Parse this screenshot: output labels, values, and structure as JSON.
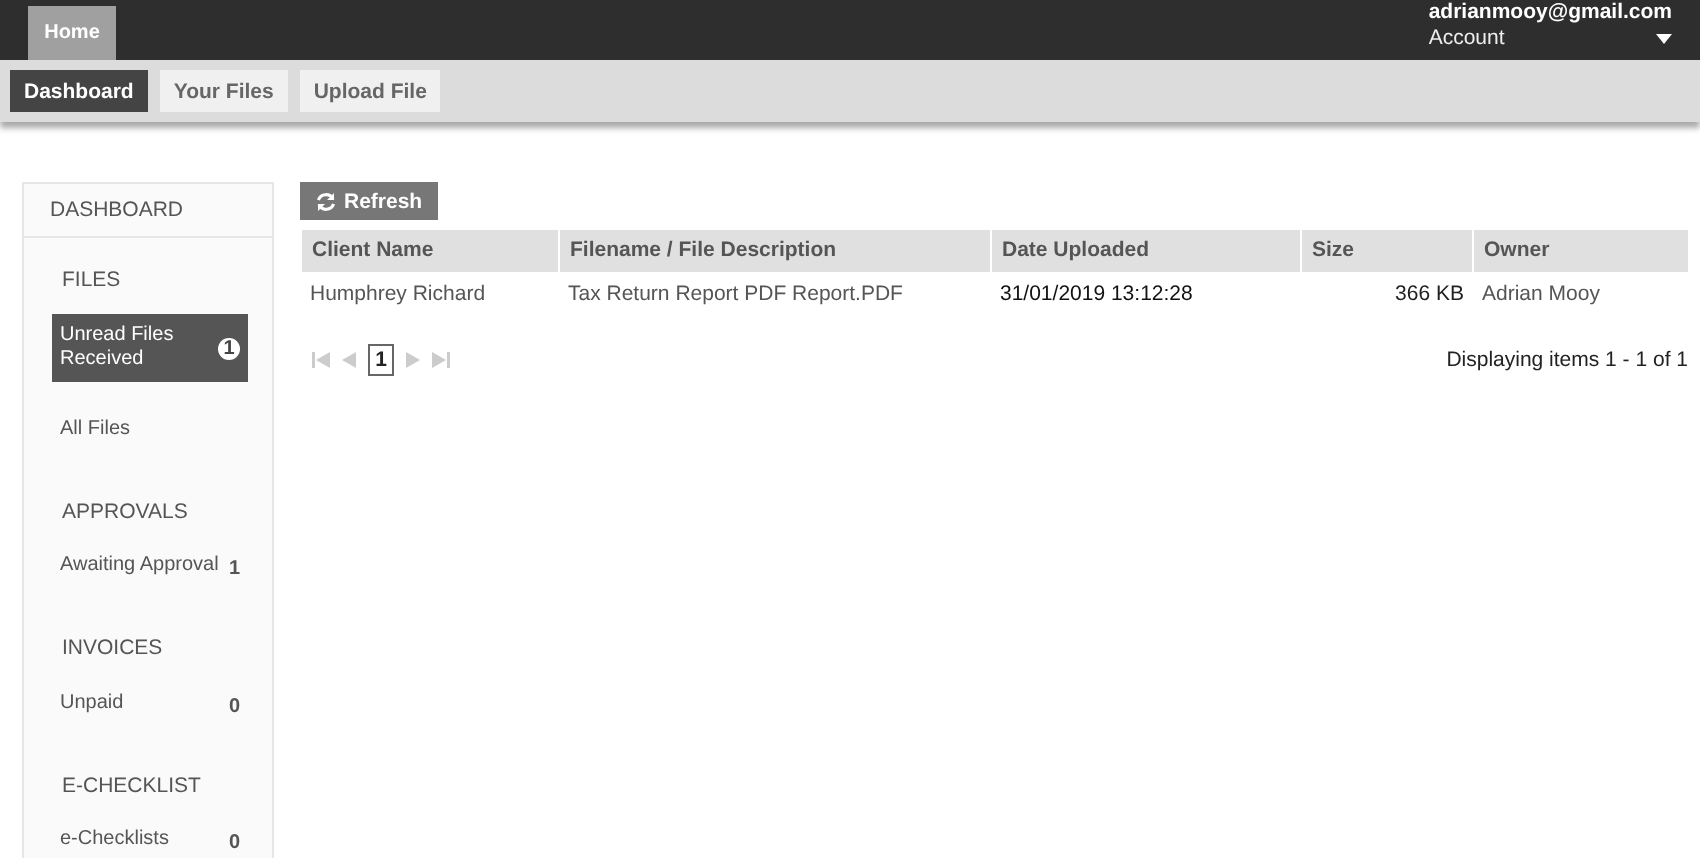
{
  "topbar": {
    "tabs": [
      {
        "label": "Home",
        "selected": true
      }
    ],
    "account": {
      "email": "adrianmooy@gmail.com",
      "label": "Account"
    }
  },
  "subnav": [
    {
      "label": "Dashboard",
      "selected": true
    },
    {
      "label": "Your Files",
      "selected": false
    },
    {
      "label": "Upload File",
      "selected": false
    }
  ],
  "sidebar": {
    "title": "DASHBOARD",
    "sections": [
      {
        "title": "FILES",
        "items": [
          {
            "label": "Unread Files Received",
            "count": "1",
            "selected": true
          },
          {
            "label": "All Files",
            "selected": false
          }
        ]
      },
      {
        "title": "APPROVALS",
        "items": [
          {
            "label": "Awaiting Approval",
            "count": "1",
            "selected": false
          }
        ]
      },
      {
        "title": "INVOICES",
        "items": [
          {
            "label": "Unpaid",
            "count": "0",
            "selected": false
          }
        ]
      },
      {
        "title": "E-CHECKLIST",
        "items": [
          {
            "label": "e-Checklists",
            "count": "0",
            "selected": false
          }
        ]
      }
    ]
  },
  "refresh_button": "Refresh",
  "table": {
    "columns": [
      "Client Name",
      "Filename / File Description",
      "Date Uploaded",
      "Size",
      "Owner"
    ],
    "rows": [
      [
        "Humphrey Richard",
        "Tax Return Report PDF Report.PDF",
        "31/01/2019 13:12:28",
        "366 KB",
        "Adrian Mooy"
      ]
    ]
  },
  "pager": {
    "page": "1",
    "status": "Displaying items 1 - 1 of 1"
  }
}
